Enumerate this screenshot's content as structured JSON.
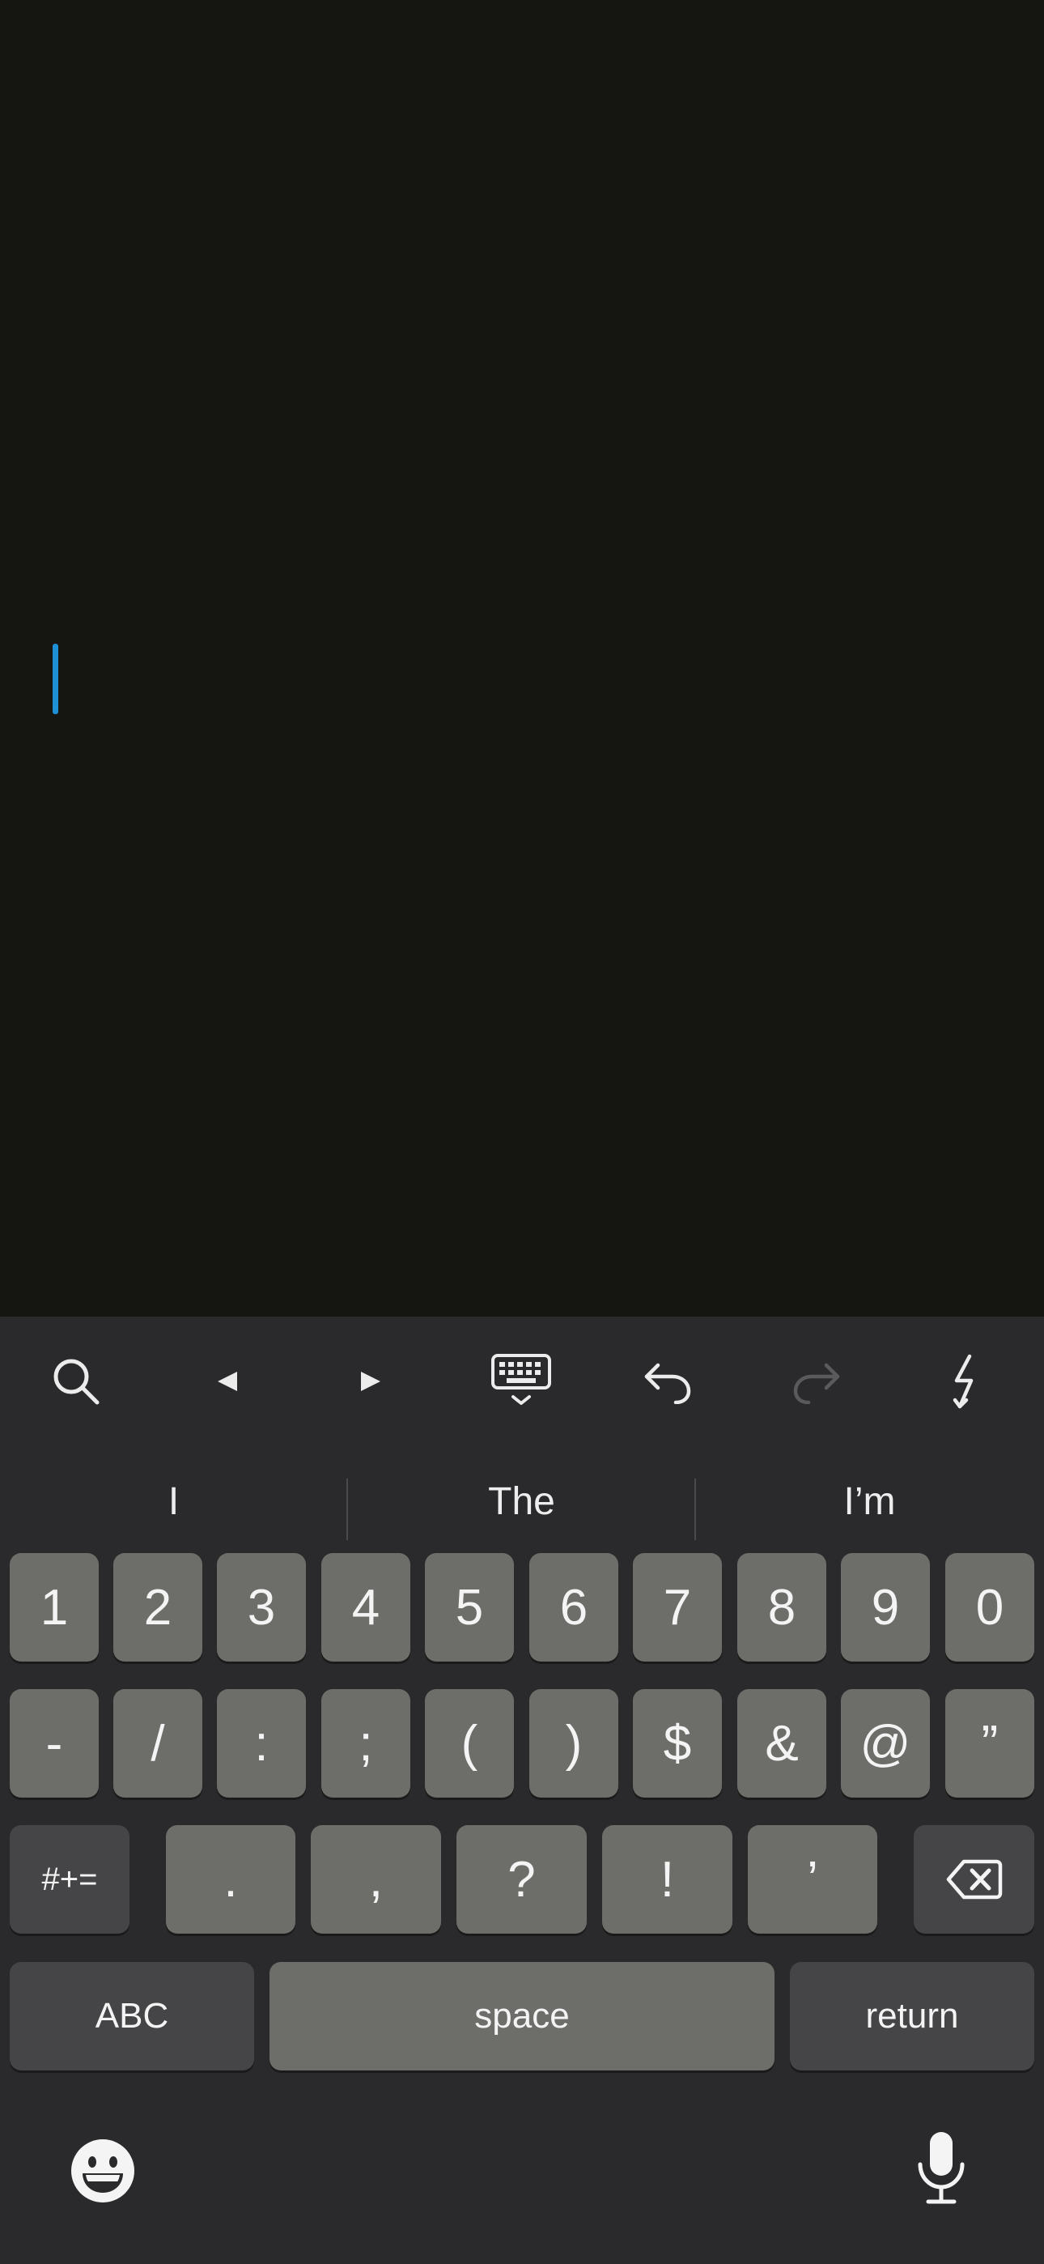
{
  "editor": {
    "text": ""
  },
  "toolbar": {
    "icons": [
      "search-icon",
      "arrow-left-icon",
      "arrow-right-icon",
      "keyboard-dismiss-icon",
      "undo-icon",
      "redo-icon",
      "lightning-icon"
    ],
    "redo_enabled": false
  },
  "suggestions": [
    "I",
    "The",
    "I’m"
  ],
  "keyboard": {
    "row1": [
      "1",
      "2",
      "3",
      "4",
      "5",
      "6",
      "7",
      "8",
      "9",
      "0"
    ],
    "row2": [
      "-",
      "/",
      ":",
      ";",
      "(",
      ")",
      "$",
      "&",
      "@",
      "”"
    ],
    "row3": {
      "symbols_toggle": "#+=",
      "keys": [
        ".",
        ",",
        "?",
        "!",
        "’"
      ],
      "delete_icon": "backspace-icon"
    },
    "row4": {
      "abc": "ABC",
      "space": "space",
      "return": "return"
    },
    "bottom": {
      "emoji_icon": "emoji-icon",
      "mic_icon": "microphone-icon"
    }
  },
  "colors": {
    "background": "#151512",
    "keyboard": "#2a2a2c",
    "key": "#6d6d69",
    "key_dark": "#454547",
    "caret": "#1e90d6"
  }
}
